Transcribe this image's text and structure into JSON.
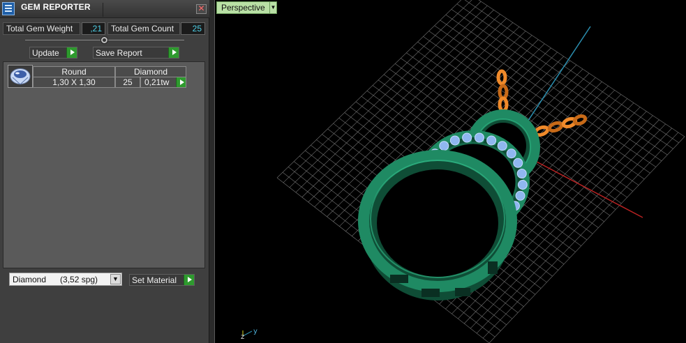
{
  "panel": {
    "title": "GEM REPORTER",
    "close_glyph": "✕",
    "total_weight_label": "Total Gem Weight",
    "total_weight_value": ",21",
    "total_count_label": "Total Gem Count",
    "total_count_value": "25",
    "update_label": "Update",
    "save_report_label": "Save Report"
  },
  "gem_table": {
    "columns": [
      "Round",
      "Diamond"
    ],
    "rows": [
      {
        "size": "1,30 X 1,30",
        "count": "25",
        "weight": "0,21tw"
      }
    ]
  },
  "material": {
    "selected": "Diamond      (3,52 spg)",
    "set_label": "Set Material"
  },
  "viewport": {
    "view_label": "Perspective",
    "axis_labels": [
      "z",
      "y"
    ]
  },
  "colors": {
    "metal_green": "#1f8a63",
    "gem_blue": "#8fb7f0",
    "chain_orange": "#f08a2a",
    "grid": "#9a9a9a",
    "x_axis": "#b82222",
    "y_axis": "#2b8fb0"
  },
  "icons": [
    "app-icon",
    "close-icon",
    "gem-thumbnail-icon",
    "dropdown-arrow-icon",
    "play-arrow-icon"
  ]
}
